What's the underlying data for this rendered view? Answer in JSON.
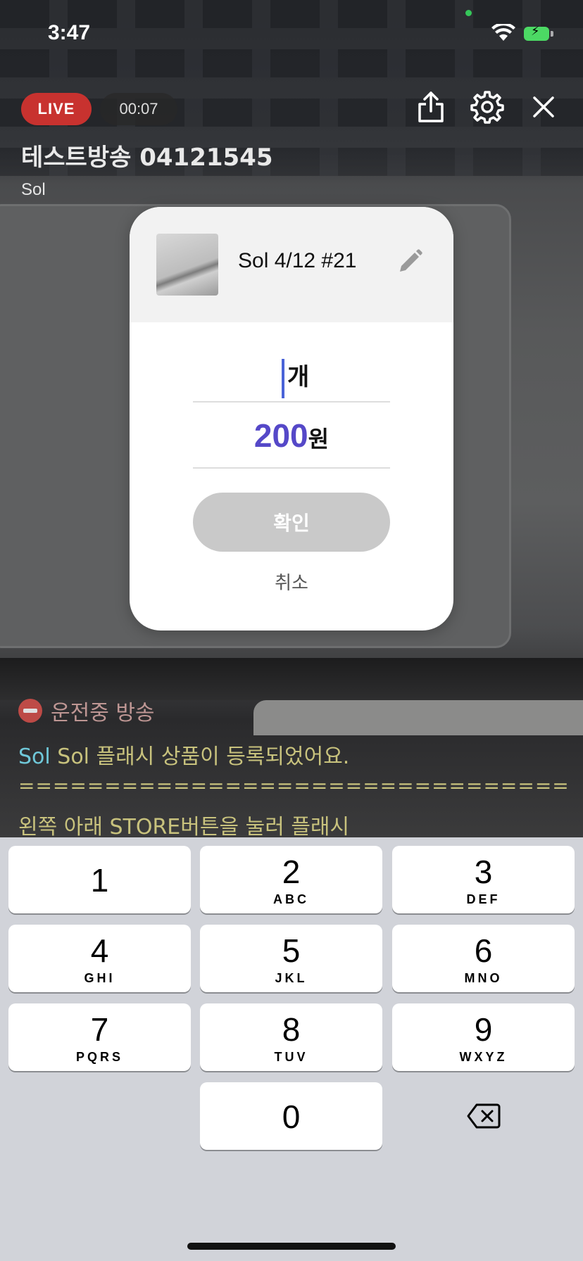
{
  "status_bar": {
    "time": "3:47"
  },
  "broadcast": {
    "live_label": "LIVE",
    "elapsed": "00:07",
    "title": "테스트방송 04121545",
    "host": "Sol"
  },
  "chat": {
    "line1": "운전중 방송",
    "line2_name": "Sol",
    "line2_text": " Sol 플래시 상품이 등록되었어요.",
    "line3": "================================",
    "line4": "왼쪽 아래 STORE버튼을 눌러 플래시"
  },
  "modal": {
    "product_name": "Sol 4/12 #21",
    "quantity_unit": "개",
    "price_value": "200",
    "price_unit": "원",
    "confirm_label": "확인",
    "cancel_label": "취소"
  },
  "keypad": {
    "keys": [
      {
        "digit": "1",
        "letters": ""
      },
      {
        "digit": "2",
        "letters": "ABC"
      },
      {
        "digit": "3",
        "letters": "DEF"
      },
      {
        "digit": "4",
        "letters": "GHI"
      },
      {
        "digit": "5",
        "letters": "JKL"
      },
      {
        "digit": "6",
        "letters": "MNO"
      },
      {
        "digit": "7",
        "letters": "PQRS"
      },
      {
        "digit": "8",
        "letters": "TUV"
      },
      {
        "digit": "9",
        "letters": "WXYZ"
      },
      {
        "digit": "0",
        "letters": ""
      }
    ]
  },
  "icons": {
    "share": "share-icon",
    "settings": "gear-icon",
    "close": "close-icon",
    "edit": "pencil-icon",
    "backspace": "backspace-icon"
  },
  "colors": {
    "live": "#c8322f",
    "price_accent": "#5548c8",
    "caret": "#4a63d8",
    "confirm_disabled": "#c9c9c9",
    "keypad_bg": "#d1d3d9"
  }
}
